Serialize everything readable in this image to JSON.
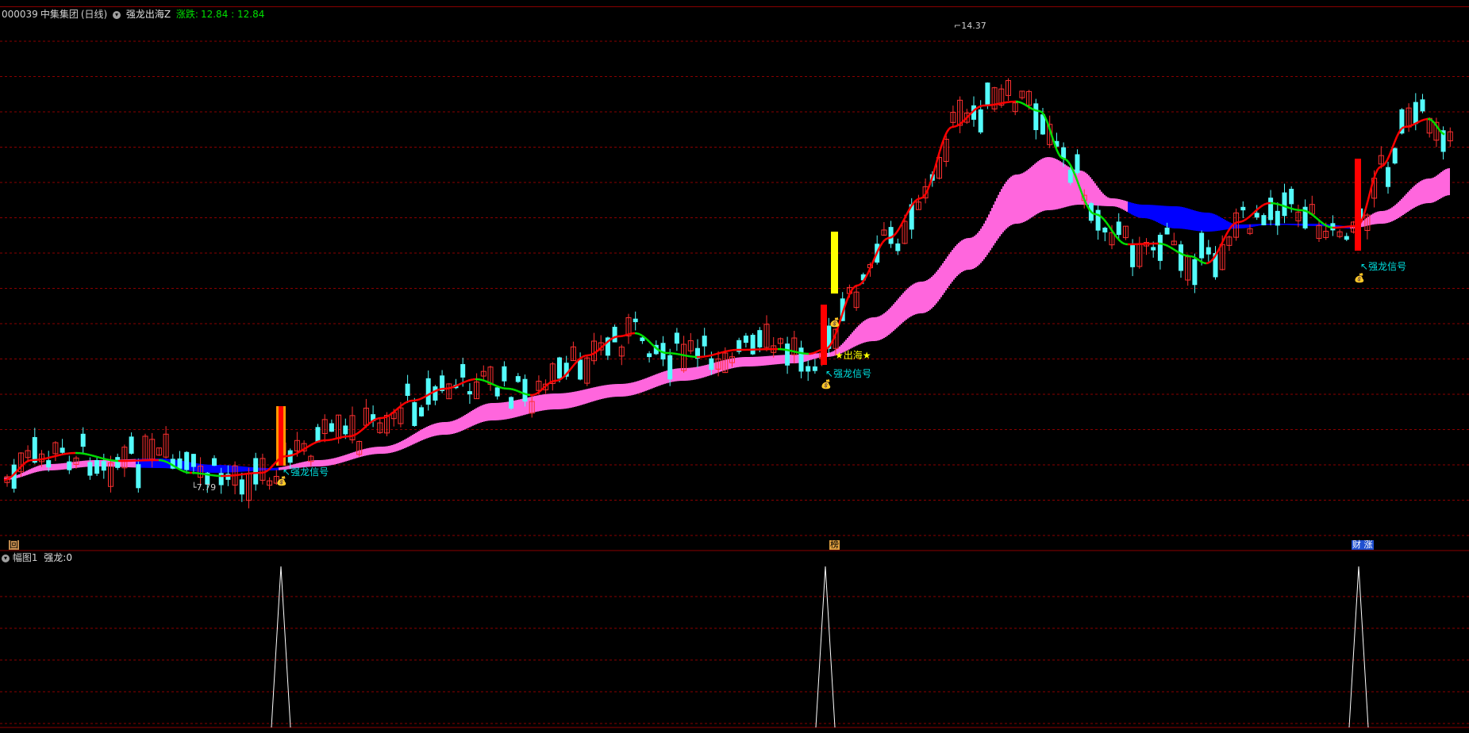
{
  "top_menu": [],
  "top_right_buttons": [],
  "stock": {
    "code": "000039",
    "name": "中集集团",
    "period": "(日线)",
    "indicator": "强龙出海Z",
    "change_label": "涨跌:",
    "change_values": "12.84 : 12.84"
  },
  "annotations": {
    "high_price": "14.37",
    "low_price": "7.79",
    "signal_label": "强龙信号",
    "sea_label": "★出海★"
  },
  "markers": {
    "left": "回",
    "mid": "榜",
    "right": "财 涨"
  },
  "sub_panel": {
    "title": "幅图1",
    "indicator_label": "强龙:",
    "indicator_value": "0"
  },
  "colors": {
    "background": "#000000",
    "up_candle": "#ff3030",
    "down_candle": "#54fcfc",
    "ma_red": "#ff0000",
    "ma_green": "#00e000",
    "band_pink": "#ff66dd",
    "band_blue": "#0000ff",
    "grid": "#8a0000",
    "signal_text": "#00e0e0",
    "sea_text": "#ffff00"
  },
  "icons": {
    "money_bag": "money-bag-icon",
    "collapse": "chevron-down-icon"
  }
}
